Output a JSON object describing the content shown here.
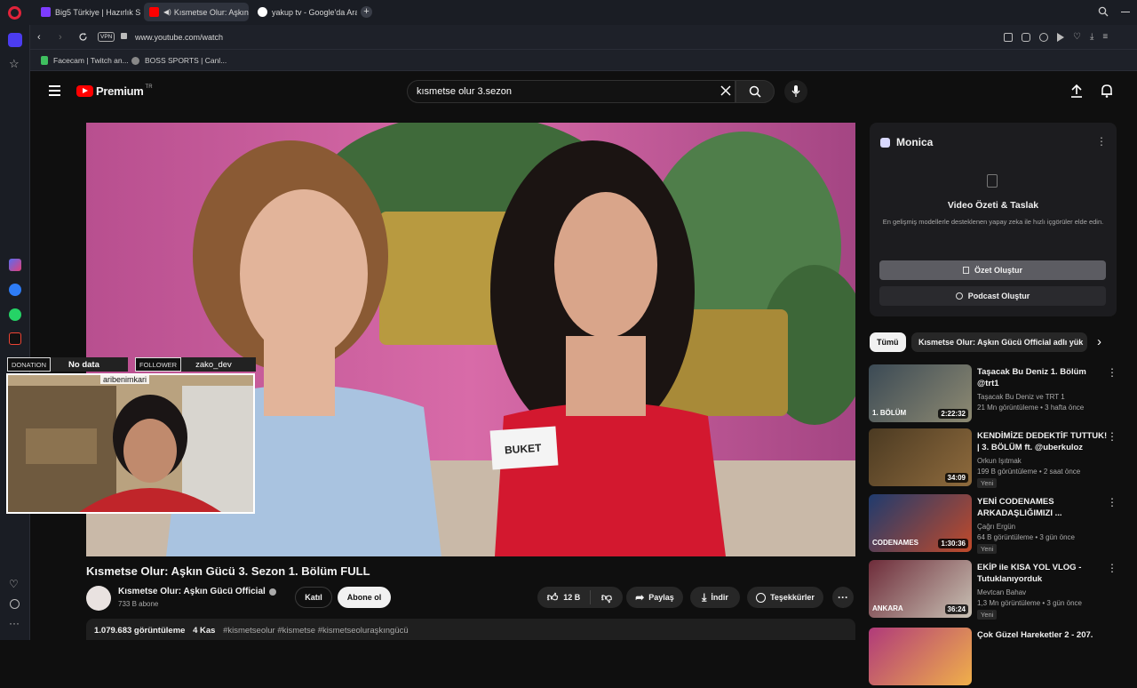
{
  "browser": {
    "tabs": [
      {
        "label": "Big5 Türkiye | Hazırlık Sez"
      },
      {
        "label": "Kısmetse Olur: Aşkın G"
      },
      {
        "label": "yakup tv - Google'da Ara"
      }
    ],
    "address": "www.youtube.com/watch",
    "vpn_label": "VPN",
    "bookmarks": [
      {
        "label": "Facecam | Twitch an..."
      },
      {
        "label": "BOSS SPORTS | Canl..."
      }
    ]
  },
  "youtube": {
    "logo_text": "Premium",
    "logo_region": "TR",
    "search_value": "kısmetse olur  3.sezon",
    "video_title": "Kısmetse Olur: Aşkın Gücü 3. Sezon 1. Bölüm FULL",
    "channel_name": "Kısmetse Olur: Aşkın Gücü Official",
    "subscribers": "733 B abone",
    "join_label": "Katıl",
    "subscribe_label": "Abone ol",
    "likes": "12 B",
    "share_label": "Paylaş",
    "download_label": "İndir",
    "thanks_label": "Teşekkürler",
    "description": {
      "views": "1.079.683 görüntüleme",
      "date": "4 Kas",
      "tags": "#kismetseolur #kismetse #kismetseoluraşkıngücü"
    },
    "name_tag": "BUKET"
  },
  "monica": {
    "title": "Monica",
    "heading": "Video Özeti & Taslak",
    "desc": "En gelişmiş modellerle desteklenen yapay zeka ile hızlı içgörüler elde edin.",
    "summary_button": "Özet Oluştur",
    "podcast_button": "Podcast Oluştur"
  },
  "chips": [
    {
      "label": "Tümü"
    },
    {
      "label": "Kısmetse Olur: Aşkın Gücü Official adlı yük"
    }
  ],
  "recommendations": [
    {
      "title": "Taşacak Bu Deniz 1. Bölüm @trt1",
      "channel": "Taşacak Bu Deniz  ve TRT 1",
      "meta": "21 Mn görüntüleme • 3 hafta önce",
      "duration": "2:22:32",
      "badge": "",
      "thumb_text": "1. BÖLÜM",
      "colors": [
        "#3b4a55",
        "#8e8a72"
      ]
    },
    {
      "title": "KENDİMİZE DEDEKTİF TUTTUK! | 3. BÖLÜM ft. @uberkuloz",
      "channel": "Orkun Işıtmak",
      "meta": "199 B görüntüleme • 2 saat önce",
      "duration": "34:09",
      "badge": "Yeni",
      "thumb_text": "",
      "colors": [
        "#4b3a22",
        "#8f6b3d"
      ]
    },
    {
      "title": "YENİ CODENAMES ARKADAŞLIĞIMIZI ...",
      "channel": "Çağrı Ergün",
      "meta": "64 B görüntüleme • 3 gün önce",
      "duration": "1:30:36",
      "badge": "Yeni",
      "thumb_text": "CODENAMES",
      "colors": [
        "#1f3b6e",
        "#c24a2a"
      ]
    },
    {
      "title": "EKİP ile KISA YOL VLOG - Tutuklanıyorduk",
      "channel": "Mevtcan Bahav",
      "meta": "1,3 Mn görüntüleme • 3 gün önce",
      "duration": "36:24",
      "badge": "Yeni",
      "thumb_text": "ANKARA",
      "colors": [
        "#6e2c3a",
        "#c9c2b5"
      ]
    },
    {
      "title": "Çok Güzel Hareketler 2 - 207.",
      "channel": "",
      "meta": "",
      "duration": "",
      "badge": "",
      "thumb_text": "",
      "colors": [
        "#b03a7a",
        "#f0b04a"
      ]
    }
  ],
  "overlay": {
    "donation_label": "DONATION",
    "donation_value": "No data",
    "follower_label": "FOLLOWER",
    "follower_value": "zako_dev",
    "webcam_caption": "aribenimkari"
  }
}
